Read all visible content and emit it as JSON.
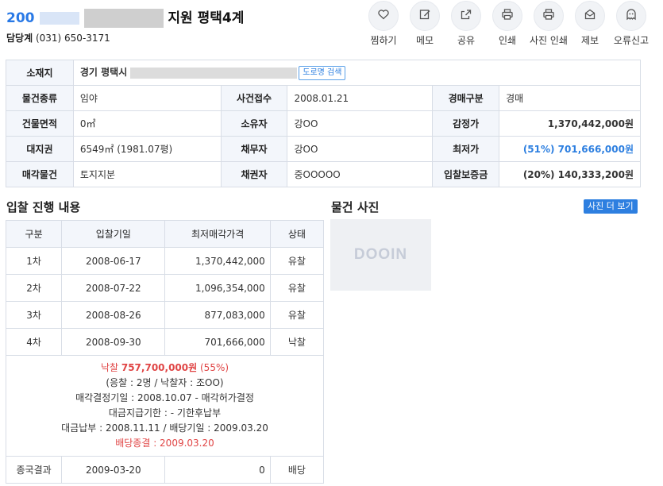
{
  "header": {
    "case_no_prefix": "200",
    "court_title": "지원 평택4계",
    "contact_label": "담당계",
    "contact_phone": "(031) 650-3171"
  },
  "actions": [
    {
      "label": "찜하기",
      "icon": "heart-icon"
    },
    {
      "label": "메모",
      "icon": "memo-icon"
    },
    {
      "label": "공유",
      "icon": "share-icon"
    },
    {
      "label": "인쇄",
      "icon": "print-icon"
    },
    {
      "label": "사진 인쇄",
      "icon": "photo-print-icon"
    },
    {
      "label": "제보",
      "icon": "envelope-icon"
    },
    {
      "label": "오류신고",
      "icon": "ghost-icon"
    }
  ],
  "info": {
    "location_label": "소재지",
    "location_value": "경기 평택시",
    "road_search_label": "도로명 검색",
    "rows": [
      [
        {
          "h": "물건종류"
        },
        {
          "v": "임야"
        },
        {
          "h": "사건접수"
        },
        {
          "v": "2008.01.21"
        },
        {
          "h": "경매구분"
        },
        {
          "v": "경매"
        }
      ],
      [
        {
          "h": "건물면적"
        },
        {
          "v": "0㎡"
        },
        {
          "h": "소유자"
        },
        {
          "v": "강OO"
        },
        {
          "h": "감정가"
        },
        {
          "v": "1,370,442,000원",
          "style": "r"
        }
      ],
      [
        {
          "h": "대지권"
        },
        {
          "v": "6549㎡ (1981.07평)"
        },
        {
          "h": "채무자"
        },
        {
          "v": "강OO"
        },
        {
          "h": "최저가"
        },
        {
          "v": "(51%) 701,666,000원",
          "style": "r blue"
        }
      ],
      [
        {
          "h": "매각물건"
        },
        {
          "v": "토지지분"
        },
        {
          "h": "채권자"
        },
        {
          "v": "중OOOOO"
        },
        {
          "h": "입찰보증금"
        },
        {
          "v": "(20%) 140,333,200원",
          "style": "r"
        }
      ]
    ]
  },
  "bidding": {
    "title": "입찰 진행 내용",
    "headers": [
      "구분",
      "입찰기일",
      "최저매각가격",
      "상태"
    ],
    "rows": [
      [
        "1차",
        "2008-06-17",
        "1,370,442,000",
        "유찰"
      ],
      [
        "2차",
        "2008-07-22",
        "1,096,354,000",
        "유찰"
      ],
      [
        "3차",
        "2008-08-26",
        "877,083,000",
        "유찰"
      ],
      [
        "4차",
        "2008-09-30",
        "701,666,000",
        "낙찰"
      ]
    ],
    "summary": {
      "sold_label": "낙찰",
      "sold_amount": "757,700,000원",
      "sold_pct": "(55%)",
      "bidders": "(응찰 : 2명 / 낙찰자 : 조OO)",
      "decision": "매각결정기일 : 2008.10.07 - 매각허가결정",
      "payment_deadline": "대금지급기한 : - 기한후납부",
      "payment": "대금납부 : 2008.11.11 / 배당기일 : 2009.03.20",
      "dividend_end": "배당종결 : 2009.03.20"
    },
    "final": {
      "label": "종국결과",
      "date": "2009-03-20",
      "amount": "0",
      "status": "배당"
    }
  },
  "photos": {
    "title": "물건 사진",
    "more_label": "사진 더 보기",
    "logo_text": "DOOIN"
  }
}
